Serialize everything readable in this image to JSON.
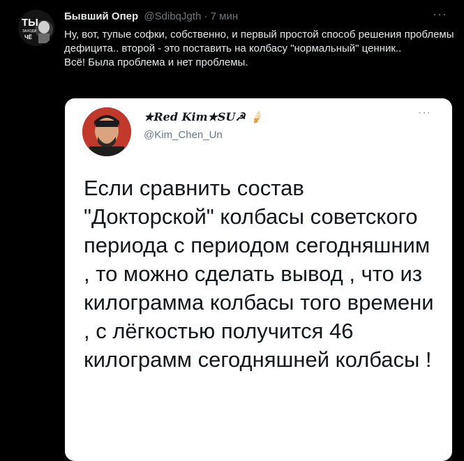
{
  "tweet": {
    "author_name": "Бывший Опер",
    "author_handle": "@SdibqJgth",
    "separator": "·",
    "time": "7 мин",
    "more_label": "···",
    "avatar_text": "ТЫ ЗАХОДИ ЧЁ",
    "text_lines": [
      "Ну, вот, тупые софки, собственно, и первый простой способ решения проблемы дефицита.. второй -  это поставить на колбасу \"нормальный\" ценник..",
      "Всё! Была проблема и нет проблемы."
    ]
  },
  "quoted": {
    "author_name": "★Red Kim★SU☭ 🍦",
    "author_handle": "@Kim_Chen_Un",
    "more_label": "···",
    "body": "Если сравнить состав \"Докторской\" колбасы советского периода с периодом сегодняшним , то можно сделать вывод , что из килограмма колбасы того времени , с лёгкостью получится 46 килограмм сегодняшней колбасы !"
  }
}
